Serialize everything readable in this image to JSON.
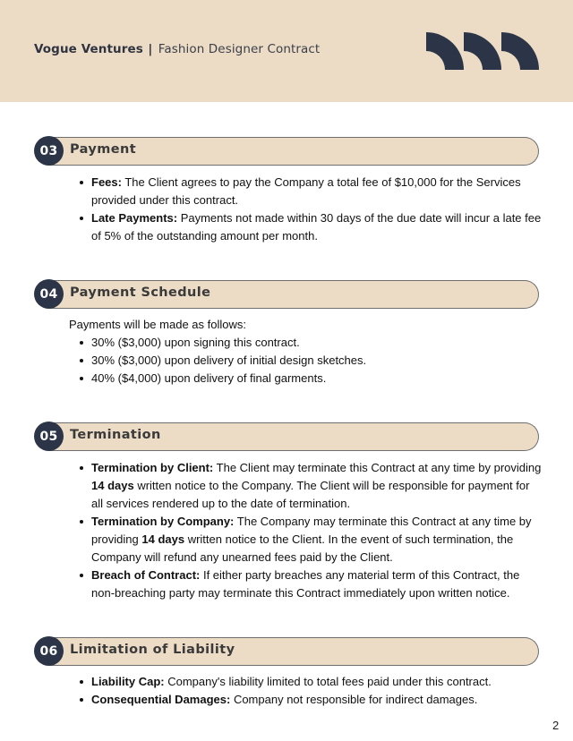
{
  "header": {
    "brand": "Vogue Ventures",
    "separator": "|",
    "document_title": "Fashion Designer Contract",
    "decoration_icon": "three-quarter-arcs",
    "accent_color": "#ecdcc6",
    "dark_color": "#2b3547"
  },
  "sections": [
    {
      "number": "03",
      "title": "Payment",
      "intro": null,
      "items": [
        {
          "label": "Fees:",
          "parts": [
            {
              "t": " The Client agrees to pay the Company a total fee of $10,000 for the Services provided under this contract.",
              "b": false
            }
          ]
        },
        {
          "label": "Late Payments:",
          "parts": [
            {
              "t": " Payments not made within 30 days of the due date will incur a late fee of 5% of the outstanding amount per month.",
              "b": false
            }
          ]
        }
      ]
    },
    {
      "number": "04",
      "title": "Payment Schedule",
      "intro": "Payments will be made as follows:",
      "items": [
        {
          "label": "",
          "parts": [
            {
              "t": "30% ($3,000) upon signing this contract.",
              "b": false
            }
          ]
        },
        {
          "label": "",
          "parts": [
            {
              "t": "30% ($3,000) upon delivery of initial design sketches.",
              "b": false
            }
          ]
        },
        {
          "label": "",
          "parts": [
            {
              "t": "40% ($4,000) upon delivery of final garments.",
              "b": false
            }
          ]
        }
      ]
    },
    {
      "number": "05",
      "title": "Termination",
      "intro": null,
      "items": [
        {
          "label": "Termination by Client:",
          "parts": [
            {
              "t": " The Client may terminate this Contract at any time by providing ",
              "b": false
            },
            {
              "t": "14 days",
              "b": true
            },
            {
              "t": " written notice to the Company. The Client will be responsible for payment for all services rendered up to the date of termination.",
              "b": false
            }
          ]
        },
        {
          "label": "Termination by Company:",
          "parts": [
            {
              "t": " The Company may terminate this Contract at any time by providing ",
              "b": false
            },
            {
              "t": "14 days",
              "b": true
            },
            {
              "t": " written notice to the Client. In the event of such termination, the Company will refund any unearned fees paid by the Client.",
              "b": false
            }
          ]
        },
        {
          "label": "Breach of Contract:",
          "parts": [
            {
              "t": " If either party breaches any material term of this Contract, the non-breaching party may terminate this Contract immediately upon written notice.",
              "b": false
            }
          ]
        }
      ]
    },
    {
      "number": "06",
      "title": "Limitation of Liability",
      "intro": null,
      "items": [
        {
          "label": "Liability Cap:",
          "parts": [
            {
              "t": " Company's liability limited to total fees paid under this contract.",
              "b": false
            }
          ]
        },
        {
          "label": "Consequential Damages:",
          "parts": [
            {
              "t": " Company not responsible for indirect damages.",
              "b": false
            }
          ]
        }
      ]
    }
  ],
  "footer": {
    "page_number": "2"
  }
}
